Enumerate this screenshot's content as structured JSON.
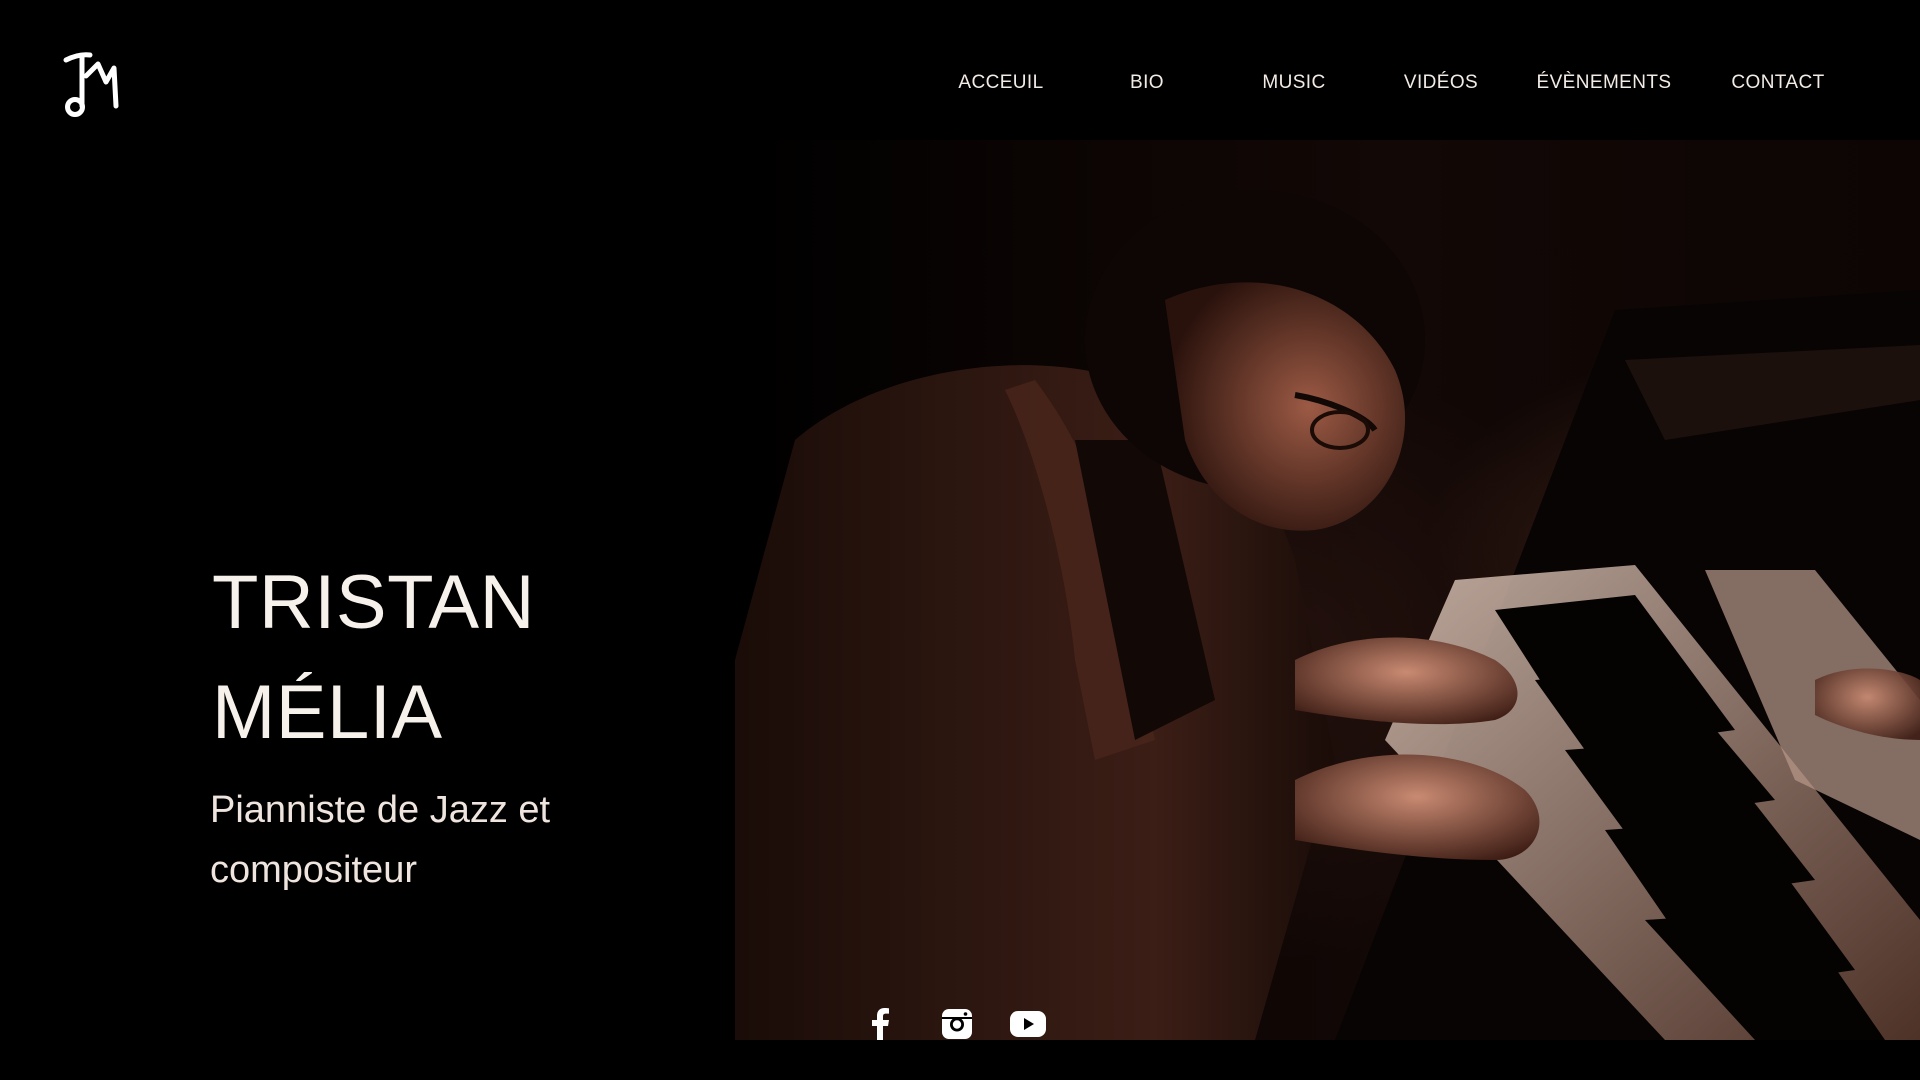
{
  "header": {
    "logo_icon": "tm-monogram-music-note-icon",
    "nav": [
      {
        "label": "ACCEUIL"
      },
      {
        "label": "BIO"
      },
      {
        "label": "MUSIC"
      },
      {
        "label": "VIDÉOS"
      },
      {
        "label": "ÉVÈNEMENTS"
      },
      {
        "label": "CONTACT"
      }
    ]
  },
  "hero": {
    "title_line1": "TRISTAN",
    "title_line2": "MÉLIA",
    "subtitle_line1": "Pianniste de Jazz et",
    "subtitle_line2": "compositeur",
    "image": "pianist-at-piano-photo"
  },
  "social": [
    {
      "icon": "facebook-icon"
    },
    {
      "icon": "instagram-icon"
    },
    {
      "icon": "youtube-icon"
    }
  ],
  "colors": {
    "background": "#000000",
    "text": "#f4ece6",
    "accent_warm": "#8a4a35"
  }
}
